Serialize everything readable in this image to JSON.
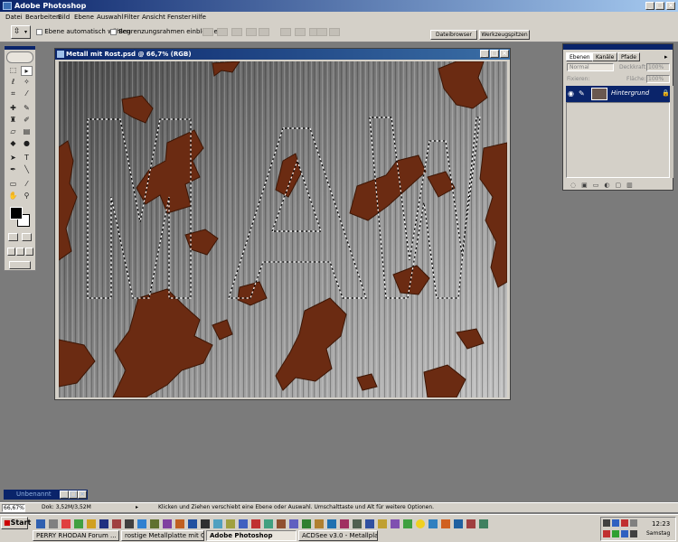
{
  "app": {
    "title": "Adobe Photoshop"
  },
  "menu": [
    "Datei",
    "Bearbeiten",
    "Bild",
    "Ebene",
    "Auswahl",
    "Filter",
    "Ansicht",
    "Fenster",
    "Hilfe"
  ],
  "options": {
    "auto_select_label": "Ebene automatisch wählen",
    "bounding_box_label": "Begrenzungsrahmen einblenden",
    "tabs": [
      "Dateibrowser",
      "Werkzeugspitzen"
    ]
  },
  "document": {
    "title": "Metall mit Rost.psd @ 66,7% (RGB)",
    "selection_text": "MAW"
  },
  "layers_palette": {
    "tabs": [
      "Ebenen",
      "Kanäle",
      "Pfade"
    ],
    "blend_mode": "Normal",
    "opacity_label": "Deckkraft:",
    "opacity_value": "100%",
    "lock_label": "Fixieren:",
    "fill_label": "Fläche:",
    "fill_value": "100%",
    "layer_name": "Hintergrund"
  },
  "mini_palette": {
    "title": "Unbenannt"
  },
  "status": {
    "zoom": "66,67%",
    "doc_size": "Dok: 3,52M/3,52M",
    "hint": "Klicken und Ziehen verschiebt eine Ebene oder Auswahl. Umschalttaste und Alt für weitere Optionen."
  },
  "taskbar": {
    "start_label": "Start",
    "tasks": [
      "PERRY RHODAN Forum ...",
      "rostige Metallplatte mit Gr...",
      "Adobe Photoshop",
      "ACDSee v3.0 - Metallplatt..."
    ],
    "clock": "12:23",
    "day": "Samstag"
  },
  "colors": {
    "title_bar": "#0a246a",
    "chrome": "#d4d0c8",
    "workspace": "#7b7b7b",
    "rust": "#6b2b12"
  }
}
